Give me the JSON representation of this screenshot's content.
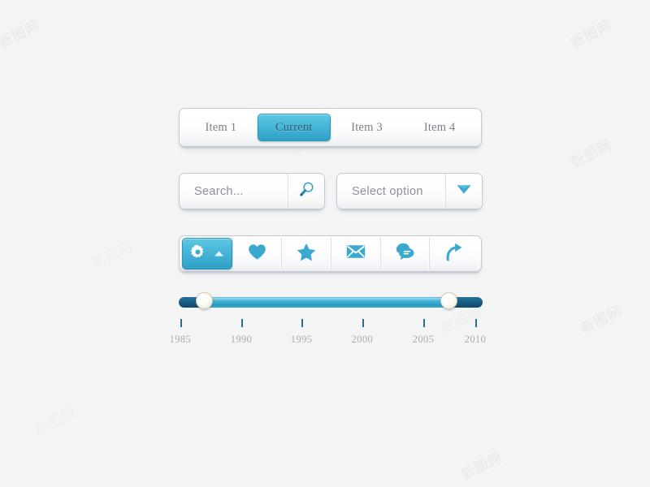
{
  "theme": {
    "background": "#f4f4f4",
    "accent": "#3eb0d4",
    "accent_dark": "#17587c",
    "border": "#c3c9d2",
    "muted_text": "#8d9097"
  },
  "watermarks": {
    "text": "新图网",
    "instances": [
      "新图网",
      "新图网",
      "新图网",
      "新图网",
      "新图网",
      "新图网",
      "新图网",
      "新图网",
      "新图网"
    ]
  },
  "tabbar": {
    "tabs": [
      {
        "label": "Item 1",
        "active": false
      },
      {
        "label": "Current",
        "active": true
      },
      {
        "label": "Item 3",
        "active": false
      },
      {
        "label": "Item 4",
        "active": false
      }
    ]
  },
  "search": {
    "placeholder": "Search...",
    "value": "",
    "icon": "search-icon"
  },
  "select": {
    "selected_label": "Select option",
    "icon": "chevron-down-icon",
    "options": [
      "Select option"
    ]
  },
  "toolbar": {
    "buttons": [
      {
        "icon": "gear-icon",
        "secondary_icon": "caret-up-icon",
        "active": true,
        "label": "Settings"
      },
      {
        "icon": "heart-icon",
        "active": false,
        "label": "Favorite"
      },
      {
        "icon": "star-icon",
        "active": false,
        "label": "Star"
      },
      {
        "icon": "envelope-icon",
        "active": false,
        "label": "Mail"
      },
      {
        "icon": "comments-icon",
        "active": false,
        "label": "Comments"
      },
      {
        "icon": "share-arrow-icon",
        "active": false,
        "label": "Share"
      }
    ]
  },
  "slider": {
    "min": 1985,
    "max": 2012,
    "low_value": 1987,
    "high_value": 2007,
    "low_handle_pct": 8.3,
    "high_handle_pct": 89.0,
    "ticks": [
      {
        "label": "1985",
        "pct": 0.5
      },
      {
        "label": "1990",
        "pct": 20.6
      },
      {
        "label": "1995",
        "pct": 40.4
      },
      {
        "label": "2000",
        "pct": 60.4
      },
      {
        "label": "2005",
        "pct": 80.5
      },
      {
        "label": "2010",
        "pct": 97.6
      }
    ]
  }
}
